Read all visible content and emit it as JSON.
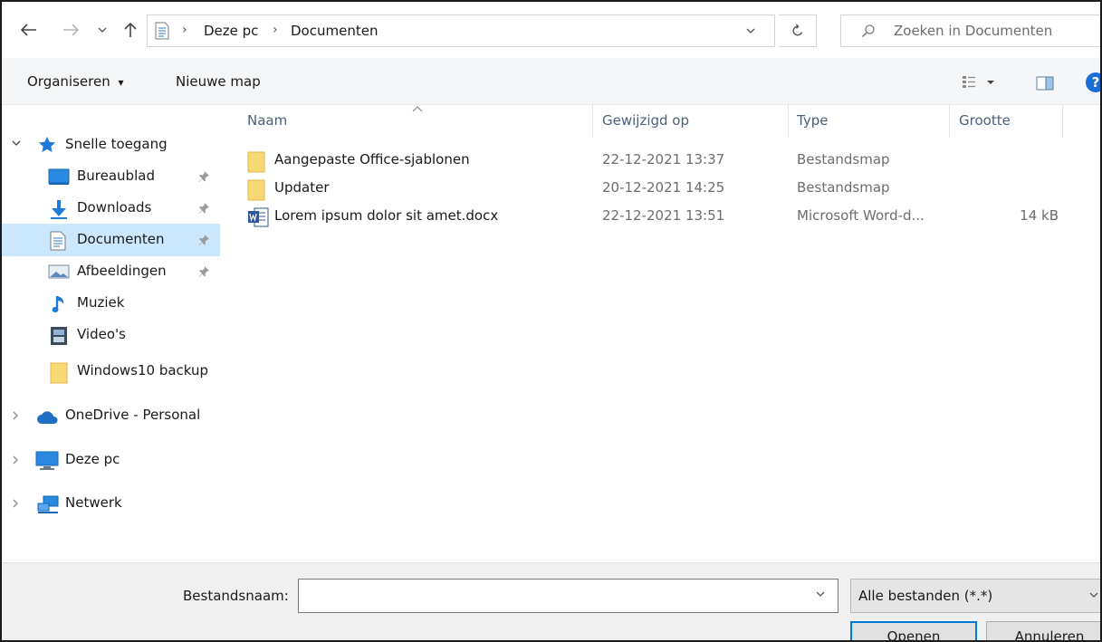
{
  "breadcrumb": {
    "items": [
      "Deze pc",
      "Documenten"
    ],
    "separator": "›"
  },
  "search": {
    "placeholder": "Zoeken in Documenten"
  },
  "toolbar": {
    "organize_label": "Organiseren",
    "organize_caret": "▾",
    "new_folder_label": "Nieuwe map",
    "help_label": "?"
  },
  "sidebar": {
    "quick_access": {
      "label": "Snelle toegang",
      "items": [
        {
          "label": "Bureaublad",
          "icon": "desktop-icon",
          "pinned": true
        },
        {
          "label": "Downloads",
          "icon": "downloads-icon",
          "pinned": true
        },
        {
          "label": "Documenten",
          "icon": "documents-icon",
          "pinned": true,
          "selected": true
        },
        {
          "label": "Afbeeldingen",
          "icon": "pictures-icon",
          "pinned": true
        },
        {
          "label": "Muziek",
          "icon": "music-icon",
          "pinned": false
        },
        {
          "label": "Video's",
          "icon": "videos-icon",
          "pinned": false
        },
        {
          "label": "Windows10 backup",
          "icon": "folder-icon",
          "pinned": false
        }
      ]
    },
    "roots": [
      {
        "label": "OneDrive - Personal",
        "icon": "onedrive-icon"
      },
      {
        "label": "Deze pc",
        "icon": "this-pc-icon"
      },
      {
        "label": "Netwerk",
        "icon": "network-icon"
      }
    ]
  },
  "file_list": {
    "columns": [
      "Naam",
      "Gewijzigd op",
      "Type",
      "Grootte"
    ],
    "rows": [
      {
        "name": "Aangepaste Office-sjablonen",
        "modified": "22-12-2021 13:37",
        "type": "Bestandsmap",
        "size": "",
        "icon": "folder-icon"
      },
      {
        "name": "Updater",
        "modified": "20-12-2021 14:25",
        "type": "Bestandsmap",
        "size": "",
        "icon": "folder-icon"
      },
      {
        "name": "Lorem ipsum dolor sit amet.docx",
        "modified": "22-12-2021 13:51",
        "type": "Microsoft Word-d...",
        "size": "14 kB",
        "icon": "word-document-icon"
      }
    ]
  },
  "footer": {
    "filename_label": "Bestandsnaam:",
    "filename_value": "",
    "filetype_value": "Alle bestanden (*.*)",
    "open_label": "Openen",
    "cancel_label": "Annuleren"
  },
  "colors": {
    "selection": "#cce8ff",
    "accent": "#0078d7",
    "help": "#1a6ed8",
    "folder": "#f8d775"
  }
}
